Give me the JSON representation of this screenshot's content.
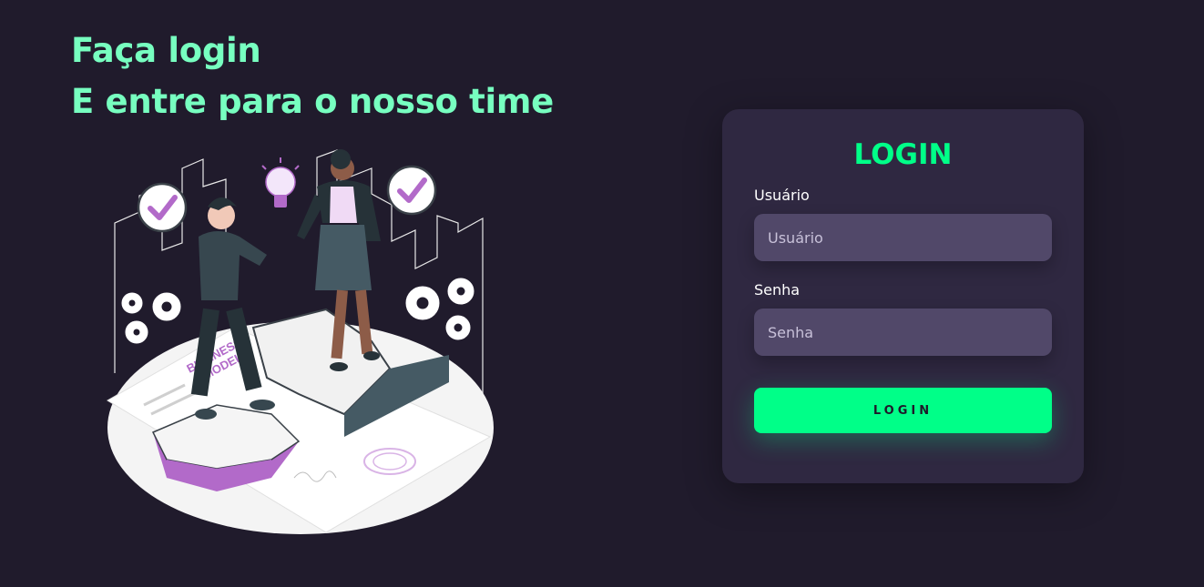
{
  "headline": {
    "line1": "Faça login",
    "line2": "E entre para o nosso time"
  },
  "illustration": {
    "badge_text_1": "BUSINESS",
    "badge_text_2": "MODEL",
    "icons": [
      "check-icon",
      "lightbulb-icon",
      "gear-icon",
      "puzzle-icon"
    ]
  },
  "login_card": {
    "title": "LOGIN",
    "username_label": "Usuário",
    "username_placeholder": "Usuário",
    "password_label": "Senha",
    "password_placeholder": "Senha",
    "button_label": "LOGIN"
  },
  "colors": {
    "background": "#201b2c",
    "accent": "#00ff88",
    "headline": "#77ffc0",
    "card": "#2f2841",
    "input": "#514869",
    "purple": "#b26ac9"
  }
}
